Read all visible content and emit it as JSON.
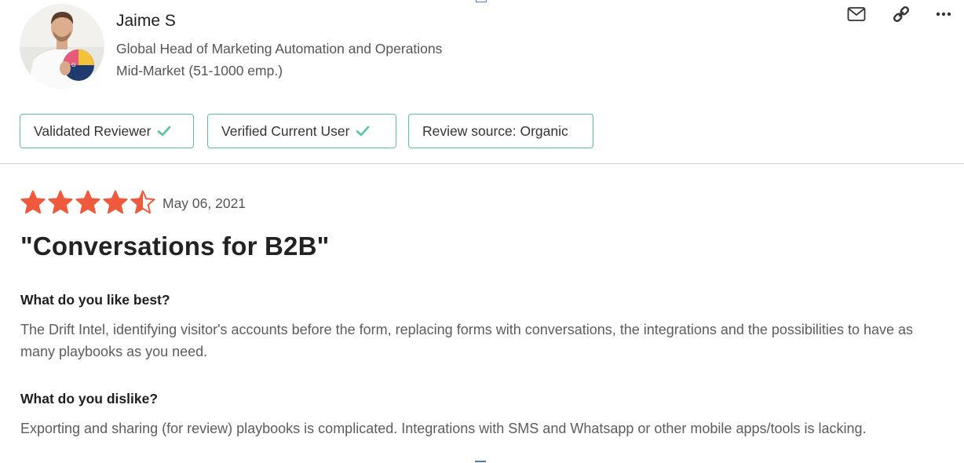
{
  "reviewer": {
    "name": "Jaime S",
    "title": "Global Head of Marketing Automation and Operations",
    "segment": "Mid-Market (51-1000 emp.)",
    "avatar_icon": "user-avatar-photo"
  },
  "actions": {
    "icons": [
      "mail-icon",
      "link-icon",
      "more-icon"
    ]
  },
  "badges": [
    {
      "label": "Validated Reviewer",
      "icon": "check-icon"
    },
    {
      "label": "Verified Current User",
      "icon": "check-icon"
    },
    {
      "label": "Review source: Organic"
    }
  ],
  "review": {
    "rating": 4.5,
    "rating_max": 5,
    "date": "May 06, 2021",
    "title": "\"Conversations for B2B\"",
    "sections": [
      {
        "question": "What do you like best?",
        "answer": "The Drift Intel, identifying visitor's accounts before the form, replacing forms with conversations, the integrations and the possibilities to have as many playbooks as you need."
      },
      {
        "question": "What do you dislike?",
        "answer": "Exporting and sharing (for review) playbooks is complicated. Integrations with SMS and Whatsapp or other mobile apps/tools is lacking."
      }
    ]
  },
  "colors": {
    "star": "#f05a3c",
    "badge_border": "#5cc3a0",
    "check": "#5cc3a0",
    "divider": "#cfcfcf"
  }
}
